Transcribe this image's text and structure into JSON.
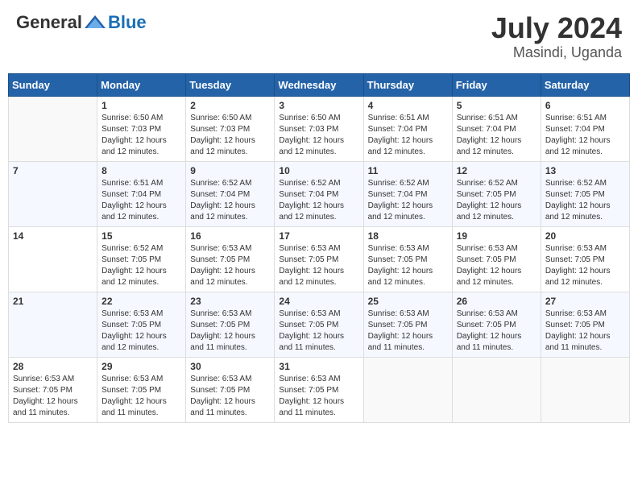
{
  "header": {
    "logo": {
      "general": "General",
      "blue": "Blue"
    },
    "title": "July 2024",
    "location": "Masindi, Uganda"
  },
  "days_of_week": [
    "Sunday",
    "Monday",
    "Tuesday",
    "Wednesday",
    "Thursday",
    "Friday",
    "Saturday"
  ],
  "weeks": [
    [
      {
        "day": "",
        "info": ""
      },
      {
        "day": "1",
        "info": "Sunrise: 6:50 AM\nSunset: 7:03 PM\nDaylight: 12 hours\nand 12 minutes."
      },
      {
        "day": "2",
        "info": "Sunrise: 6:50 AM\nSunset: 7:03 PM\nDaylight: 12 hours\nand 12 minutes."
      },
      {
        "day": "3",
        "info": "Sunrise: 6:50 AM\nSunset: 7:03 PM\nDaylight: 12 hours\nand 12 minutes."
      },
      {
        "day": "4",
        "info": "Sunrise: 6:51 AM\nSunset: 7:04 PM\nDaylight: 12 hours\nand 12 minutes."
      },
      {
        "day": "5",
        "info": "Sunrise: 6:51 AM\nSunset: 7:04 PM\nDaylight: 12 hours\nand 12 minutes."
      },
      {
        "day": "6",
        "info": "Sunrise: 6:51 AM\nSunset: 7:04 PM\nDaylight: 12 hours\nand 12 minutes."
      }
    ],
    [
      {
        "day": "7",
        "info": ""
      },
      {
        "day": "8",
        "info": "Sunrise: 6:51 AM\nSunset: 7:04 PM\nDaylight: 12 hours\nand 12 minutes."
      },
      {
        "day": "9",
        "info": "Sunrise: 6:52 AM\nSunset: 7:04 PM\nDaylight: 12 hours\nand 12 minutes."
      },
      {
        "day": "10",
        "info": "Sunrise: 6:52 AM\nSunset: 7:04 PM\nDaylight: 12 hours\nand 12 minutes."
      },
      {
        "day": "11",
        "info": "Sunrise: 6:52 AM\nSunset: 7:04 PM\nDaylight: 12 hours\nand 12 minutes."
      },
      {
        "day": "12",
        "info": "Sunrise: 6:52 AM\nSunset: 7:05 PM\nDaylight: 12 hours\nand 12 minutes."
      },
      {
        "day": "13",
        "info": "Sunrise: 6:52 AM\nSunset: 7:05 PM\nDaylight: 12 hours\nand 12 minutes."
      }
    ],
    [
      {
        "day": "14",
        "info": ""
      },
      {
        "day": "15",
        "info": "Sunrise: 6:52 AM\nSunset: 7:05 PM\nDaylight: 12 hours\nand 12 minutes."
      },
      {
        "day": "16",
        "info": "Sunrise: 6:53 AM\nSunset: 7:05 PM\nDaylight: 12 hours\nand 12 minutes."
      },
      {
        "day": "17",
        "info": "Sunrise: 6:53 AM\nSunset: 7:05 PM\nDaylight: 12 hours\nand 12 minutes."
      },
      {
        "day": "18",
        "info": "Sunrise: 6:53 AM\nSunset: 7:05 PM\nDaylight: 12 hours\nand 12 minutes."
      },
      {
        "day": "19",
        "info": "Sunrise: 6:53 AM\nSunset: 7:05 PM\nDaylight: 12 hours\nand 12 minutes."
      },
      {
        "day": "20",
        "info": "Sunrise: 6:53 AM\nSunset: 7:05 PM\nDaylight: 12 hours\nand 12 minutes."
      }
    ],
    [
      {
        "day": "21",
        "info": ""
      },
      {
        "day": "22",
        "info": "Sunrise: 6:53 AM\nSunset: 7:05 PM\nDaylight: 12 hours\nand 12 minutes."
      },
      {
        "day": "23",
        "info": "Sunrise: 6:53 AM\nSunset: 7:05 PM\nDaylight: 12 hours\nand 11 minutes."
      },
      {
        "day": "24",
        "info": "Sunrise: 6:53 AM\nSunset: 7:05 PM\nDaylight: 12 hours\nand 11 minutes."
      },
      {
        "day": "25",
        "info": "Sunrise: 6:53 AM\nSunset: 7:05 PM\nDaylight: 12 hours\nand 11 minutes."
      },
      {
        "day": "26",
        "info": "Sunrise: 6:53 AM\nSunset: 7:05 PM\nDaylight: 12 hours\nand 11 minutes."
      },
      {
        "day": "27",
        "info": "Sunrise: 6:53 AM\nSunset: 7:05 PM\nDaylight: 12 hours\nand 11 minutes."
      }
    ],
    [
      {
        "day": "28",
        "info": "Sunrise: 6:53 AM\nSunset: 7:05 PM\nDaylight: 12 hours\nand 11 minutes."
      },
      {
        "day": "29",
        "info": "Sunrise: 6:53 AM\nSunset: 7:05 PM\nDaylight: 12 hours\nand 11 minutes."
      },
      {
        "day": "30",
        "info": "Sunrise: 6:53 AM\nSunset: 7:05 PM\nDaylight: 12 hours\nand 11 minutes."
      },
      {
        "day": "31",
        "info": "Sunrise: 6:53 AM\nSunset: 7:05 PM\nDaylight: 12 hours\nand 11 minutes."
      },
      {
        "day": "",
        "info": ""
      },
      {
        "day": "",
        "info": ""
      },
      {
        "day": "",
        "info": ""
      }
    ]
  ]
}
